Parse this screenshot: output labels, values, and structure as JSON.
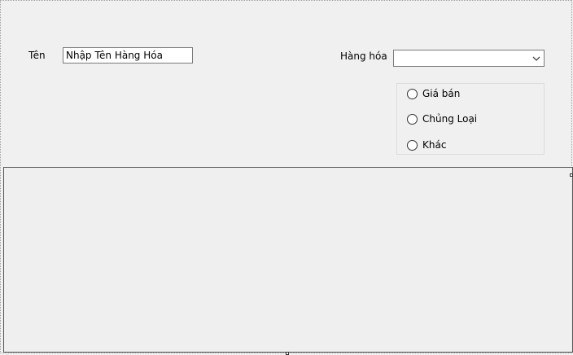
{
  "form": {
    "name_label": "Tên",
    "name_input_value": "Nhập Tên Hàng Hóa",
    "product_label": "Hàng hóa",
    "product_selected": "",
    "filter_options": [
      {
        "label": "Giá bán",
        "checked": false
      },
      {
        "label": "Chủng Loại",
        "checked": false
      },
      {
        "label": "Khác",
        "checked": false
      }
    ]
  },
  "icons": {
    "combo_arrow": "chevron-down-icon"
  },
  "colors": {
    "background": "#f0f0f0",
    "input_border": "#7a7a7a",
    "group_border": "#dcdcdc",
    "grid_border": "#555555"
  }
}
